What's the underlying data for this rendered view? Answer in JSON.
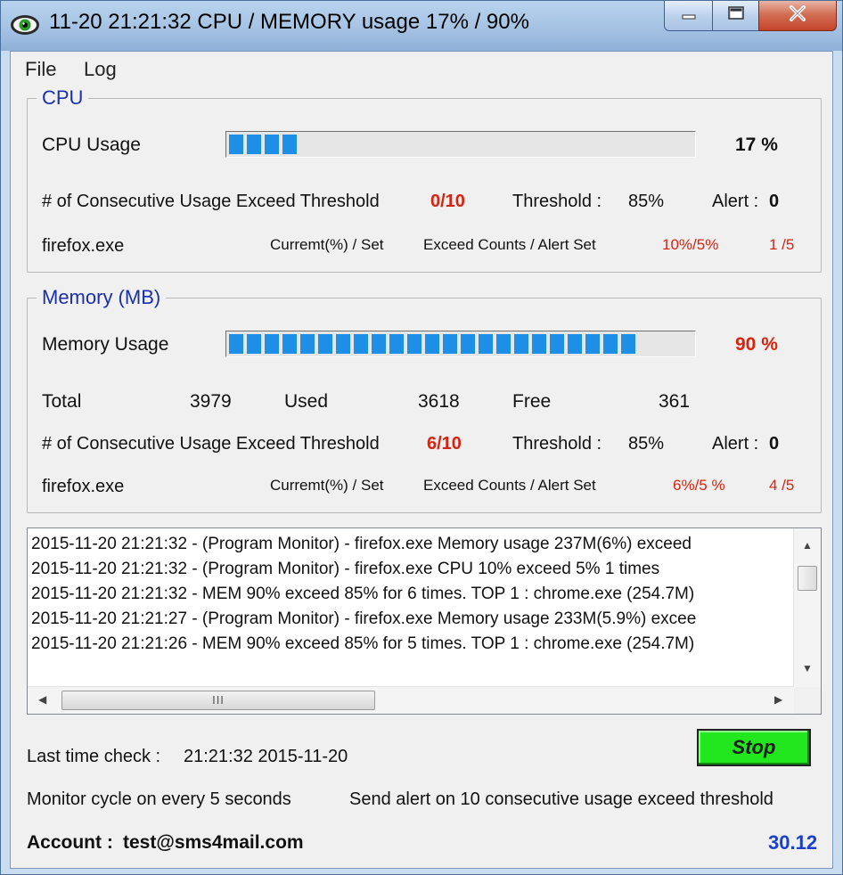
{
  "window": {
    "title": "11-20 21:21:32 CPU / MEMORY usage 17% / 90%",
    "close_glyph": "✕"
  },
  "menu": {
    "file": "File",
    "log": "Log"
  },
  "cpu": {
    "group_title": "CPU",
    "usage_label": "CPU Usage",
    "usage_percent": 17,
    "usage_text": "17 %",
    "consecutive_label": "# of Consecutive Usage Exceed Threshold",
    "consecutive_value": "0/10",
    "threshold_label": "Threshold :",
    "threshold_value": "85%",
    "alert_label": "Alert :",
    "alert_value": "0",
    "process_name": "firefox.exe",
    "current_set_label": "Curremt(%) / Set",
    "exceed_alert_label": "Exceed Counts / Alert Set",
    "current_set_value": "10%/5%",
    "exceed_alert_value": "1 /5"
  },
  "memory": {
    "group_title": "Memory (MB)",
    "usage_label": "Memory Usage",
    "usage_percent": 90,
    "usage_text": "90 %",
    "total_label": "Total",
    "total_value": "3979",
    "used_label": "Used",
    "used_value": "3618",
    "free_label": "Free",
    "free_value": "361",
    "consecutive_label": "# of Consecutive Usage Exceed Threshold",
    "consecutive_value": "6/10",
    "threshold_label": "Threshold :",
    "threshold_value": "85%",
    "alert_label": "Alert :",
    "alert_value": "0",
    "process_name": "firefox.exe",
    "current_set_label": "Curremt(%) / Set",
    "exceed_alert_label": "Exceed Counts / Alert Set",
    "current_set_value": "6%/5 %",
    "exceed_alert_value": "4 /5"
  },
  "log": {
    "lines": [
      "2015-11-20 21:21:32 - (Program Monitor) - firefox.exe Memory usage 237M(6%) exceed",
      "2015-11-20 21:21:32 - (Program Monitor) - firefox.exe CPU 10% exceed 5% 1 times",
      "2015-11-20 21:21:32 - MEM 90% exceed 85% for 6 times. TOP 1 : chrome.exe (254.7M)",
      "2015-11-20 21:21:27 - (Program Monitor) - firefox.exe Memory usage 233M(5.9%) excee",
      "2015-11-20 21:21:26 - MEM 90% exceed 85% for 5 times. TOP 1 : chrome.exe (254.7M)"
    ],
    "hthumb_grip": "III"
  },
  "status": {
    "last_check_label": "Last time check :",
    "last_check_value": "21:21:32 2015-11-20",
    "cycle_text": "Monitor cycle on every 5 seconds",
    "alert_text": "Send alert on 10 consecutive usage exceed threshold",
    "account_label": "Account :",
    "account_value": "test@sms4mail.com",
    "version": "30.12"
  },
  "stop_button": {
    "label": "Stop"
  },
  "colors": {
    "bar_segment": "#1e8fe6",
    "stop_green": "#22e61e",
    "alert_red": "#d62410",
    "group_title_blue": "#1a2fa8"
  },
  "icons": [
    "eye-icon",
    "minimize-icon",
    "maximize-icon",
    "close-icon",
    "scroll-up-icon",
    "scroll-down-icon",
    "scroll-left-icon",
    "scroll-right-icon"
  ]
}
